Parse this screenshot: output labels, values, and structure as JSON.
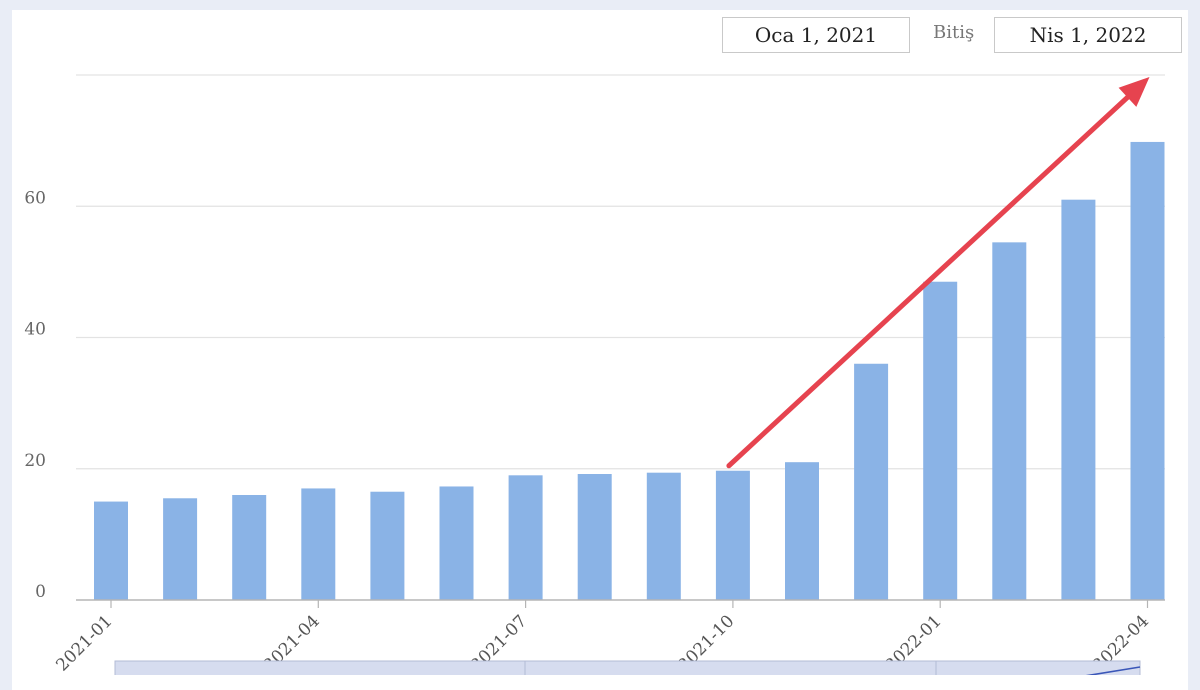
{
  "date_range": {
    "start": "Oca 1, 2021",
    "end_label": "Bitiş",
    "end": "Nis 1, 2022"
  },
  "colors": {
    "bar": "#8ab3e6",
    "arrow": "#e6434f",
    "grid": "#e3e3e3",
    "navigator_fill": "#d6dcef"
  },
  "chart_data": {
    "type": "bar",
    "title": "",
    "xlabel": "",
    "ylabel": "",
    "ylim": [
      0,
      80
    ],
    "y_ticks": [
      0,
      20,
      40,
      60
    ],
    "grid": true,
    "x_tick_labels": [
      "2021-01",
      "2021-04",
      "2021-07",
      "2021-10",
      "2022-01",
      "2022-04"
    ],
    "x_tick_positions": [
      0,
      3,
      6,
      9,
      12,
      15
    ],
    "categories": [
      "2021-01",
      "2021-02",
      "2021-03",
      "2021-04",
      "2021-05",
      "2021-06",
      "2021-07",
      "2021-08",
      "2021-09",
      "2021-10",
      "2021-11",
      "2021-12",
      "2022-01",
      "2022-02",
      "2022-03",
      "2022-04"
    ],
    "values": [
      15,
      15.5,
      16,
      17,
      16.5,
      17.3,
      19,
      19.2,
      19.4,
      19.7,
      21,
      36,
      48.5,
      54.5,
      61,
      69.8
    ],
    "annotation": {
      "type": "arrow",
      "from": {
        "x": "2021-10",
        "y": 20
      },
      "to": {
        "x": "2022-04",
        "y": 80
      }
    }
  }
}
